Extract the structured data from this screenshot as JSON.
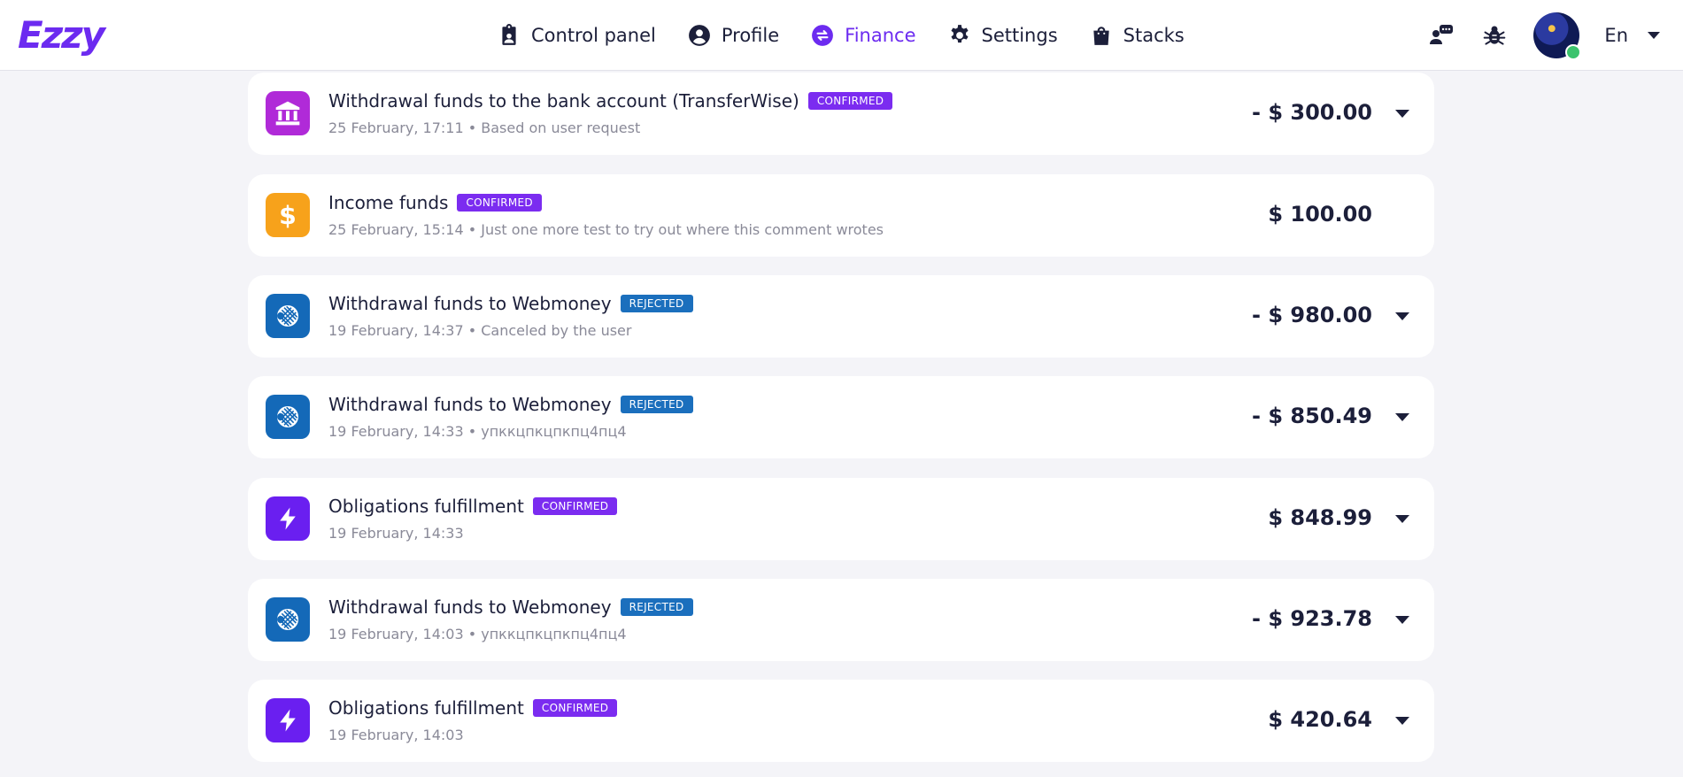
{
  "brand": {
    "logo_text": "Ezzy",
    "accent": "#6c2bf0"
  },
  "nav": [
    {
      "label": "Control panel",
      "icon": "clipboard-user-icon",
      "active": false
    },
    {
      "label": "Profile",
      "icon": "user-circle-icon",
      "active": false
    },
    {
      "label": "Finance",
      "icon": "exchange-circle-icon",
      "active": true
    },
    {
      "label": "Settings",
      "icon": "gear-icon",
      "active": false
    },
    {
      "label": "Stacks",
      "icon": "shopping-bag-icon",
      "active": false
    }
  ],
  "header_tools": {
    "chat_icon": "user-chat-icon",
    "bug_icon": "bug-icon",
    "language": "En"
  },
  "transactions": [
    {
      "icon": "bank-icon",
      "icon_color": "#b02ad8",
      "title": "Withdrawal funds to the bank account (TransferWise)",
      "status": "CONFIRMED",
      "meta": "25 February, 17:11 • Based on user request",
      "amount": "- $ 300.00",
      "expandable": true
    },
    {
      "icon": "dollar-icon",
      "icon_color": "#f7a21b",
      "title": "Income funds",
      "status": "CONFIRMED",
      "meta": "25 February, 15:14 • Just one more test to try out where this comment wrotes",
      "amount": "$ 100.00",
      "expandable": false
    },
    {
      "icon": "webmoney-icon",
      "icon_color": "#1469b8",
      "title": "Withdrawal funds to Webmoney",
      "status": "REJECTED",
      "meta": "19 February, 14:37 • Canceled by the user",
      "amount": "- $ 980.00",
      "expandable": true
    },
    {
      "icon": "webmoney-icon",
      "icon_color": "#1469b8",
      "title": "Withdrawal funds to Webmoney",
      "status": "REJECTED",
      "meta": "19 February, 14:33 • упккцпкцпкпц4пц4",
      "amount": "- $ 850.49",
      "expandable": true
    },
    {
      "icon": "lightning-icon",
      "icon_color": "#6a1ff0",
      "title": "Obligations fulfillment",
      "status": "CONFIRMED",
      "meta": "19 February, 14:33",
      "amount": "$ 848.99",
      "expandable": true
    },
    {
      "icon": "webmoney-icon",
      "icon_color": "#1469b8",
      "title": "Withdrawal funds to Webmoney",
      "status": "REJECTED",
      "meta": "19 February, 14:03 • упккцпкцпкпц4пц4",
      "amount": "- $ 923.78",
      "expandable": true
    },
    {
      "icon": "lightning-icon",
      "icon_color": "#6a1ff0",
      "title": "Obligations fulfillment",
      "status": "CONFIRMED",
      "meta": "19 February, 14:03",
      "amount": "$ 420.64",
      "expandable": true
    }
  ]
}
